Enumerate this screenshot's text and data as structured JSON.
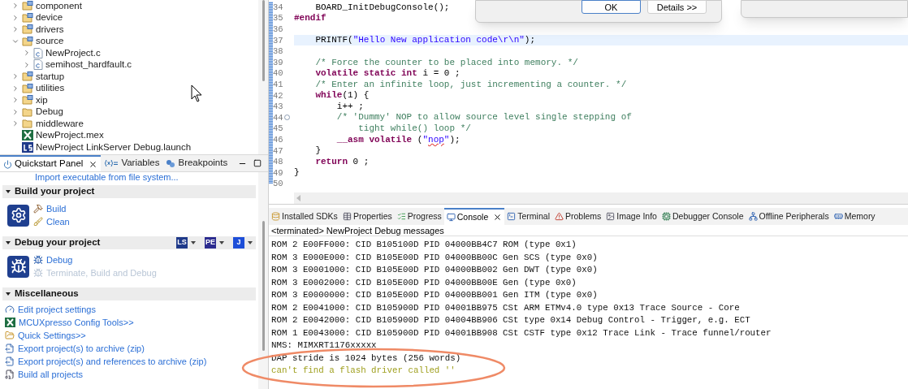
{
  "project_tree": [
    {
      "label": "component",
      "kind": "source_folder",
      "expanded": false
    },
    {
      "label": "device",
      "kind": "source_folder",
      "expanded": false
    },
    {
      "label": "drivers",
      "kind": "source_folder",
      "expanded": false
    },
    {
      "label": "source",
      "kind": "source_folder",
      "expanded": true,
      "children": [
        {
          "label": "NewProject.c",
          "kind": "c_file",
          "expanded": false
        },
        {
          "label": "semihost_hardfault.c",
          "kind": "c_file",
          "expanded": false
        }
      ]
    },
    {
      "label": "startup",
      "kind": "source_folder",
      "expanded": false
    },
    {
      "label": "utilities",
      "kind": "source_folder",
      "expanded": false
    },
    {
      "label": "xip",
      "kind": "source_folder",
      "expanded": false
    },
    {
      "label": "Debug",
      "kind": "folder",
      "expanded": false
    },
    {
      "label": "middleware",
      "kind": "folder",
      "expanded": false
    },
    {
      "label": "NewProject.mex",
      "kind": "mex_file"
    },
    {
      "label": "NewProject LinkServer Debug.launch",
      "kind": "launch_file"
    }
  ],
  "left_tabs": [
    {
      "label": "Quickstart Panel",
      "kind": "power",
      "selected": true
    },
    {
      "label": "Variables",
      "kind": "variables",
      "selected": false
    },
    {
      "label": "Breakpoints",
      "kind": "breakpoints",
      "selected": false
    }
  ],
  "quickstart": {
    "top_link": "Import executable from file system...",
    "sections": [
      {
        "title": "Build your project",
        "kind": "build",
        "items": [
          {
            "label": "Build",
            "kind": "hammer",
            "disabled": false
          },
          {
            "label": "Clean",
            "kind": "broom",
            "disabled": false
          }
        ]
      },
      {
        "title": "Debug your project",
        "kind": "debug",
        "probes": [
          {
            "label": "LS",
            "color": "#1f3a8a"
          },
          {
            "label": "PE",
            "color": "#2b2b8f"
          },
          {
            "label": "J",
            "color": "#1d4ed8"
          }
        ],
        "items": [
          {
            "label": "Debug",
            "kind": "bug",
            "disabled": false
          },
          {
            "label": "Terminate, Build and Debug",
            "kind": "bug",
            "disabled": true
          }
        ]
      },
      {
        "title": "Miscellaneous",
        "kind": "misc",
        "items": [
          {
            "label": "Edit project settings",
            "kind": "gauge",
            "disabled": false
          },
          {
            "label": "MCUXpresso Config Tools>>",
            "kind": "config",
            "disabled": false
          },
          {
            "label": "Quick Settings>>",
            "kind": "folder",
            "disabled": false
          },
          {
            "label": "Export project(s) to archive (zip)",
            "kind": "export",
            "disabled": false
          },
          {
            "label": "Export project(s) and references to archive (zip)",
            "kind": "export",
            "disabled": false
          },
          {
            "label": "Build all projects",
            "kind": "binary",
            "disabled": false
          }
        ]
      }
    ]
  },
  "editor": {
    "lines": [
      {
        "number": "34",
        "current": false,
        "segments": [
          {
            "kind": "plain",
            "text": "    BOARD_InitDebugConsole();"
          }
        ]
      },
      {
        "number": "35",
        "current": false,
        "segments": [
          {
            "kind": "directive",
            "text": "#endif"
          }
        ]
      },
      {
        "number": "36",
        "current": false
      },
      {
        "number": "37",
        "current": true,
        "segments": [
          {
            "kind": "plain",
            "text": "    PRINTF("
          },
          {
            "kind": "string",
            "text": "\"Hello New application code\\r\\n\""
          },
          {
            "kind": "plain",
            "text": ");"
          }
        ]
      },
      {
        "number": "38",
        "current": false
      },
      {
        "number": "39",
        "current": false,
        "segments": [
          {
            "kind": "comment",
            "text": "    /* Force the counter to be placed into memory. */"
          }
        ]
      },
      {
        "number": "40",
        "current": false,
        "segments": [
          {
            "kind": "keyword",
            "text": "    volatile static int"
          },
          {
            "kind": "plain",
            "text": " i = 0 ;"
          }
        ]
      },
      {
        "number": "41",
        "current": false,
        "segments": [
          {
            "kind": "comment",
            "text": "    /* Enter an infinite loop, just incrementing a counter. */"
          }
        ]
      },
      {
        "number": "42",
        "current": false,
        "segments": [
          {
            "kind": "keyword",
            "text": "    while"
          },
          {
            "kind": "plain",
            "text": "(1) {"
          }
        ]
      },
      {
        "number": "43",
        "current": false,
        "segments": [
          {
            "kind": "plain",
            "text": "        i++ ;"
          }
        ]
      },
      {
        "number": "44",
        "current": false,
        "fold": true,
        "segments": [
          {
            "kind": "comment",
            "text": "        /* 'Dummy' NOP to allow source level single stepping of"
          }
        ]
      },
      {
        "number": "45",
        "current": false,
        "segments": [
          {
            "kind": "comment",
            "text": "            tight while() loop */"
          }
        ]
      },
      {
        "number": "46",
        "current": false,
        "segments": [
          {
            "kind": "keyword",
            "text": "        __asm volatile"
          },
          {
            "kind": "plain",
            "text": " ("
          },
          {
            "kind": "string",
            "text": "\""
          },
          {
            "kind": "misspelled",
            "text": "nop"
          },
          {
            "kind": "string",
            "text": "\""
          },
          {
            "kind": "plain",
            "text": ");"
          }
        ]
      },
      {
        "number": "47",
        "current": false,
        "segments": [
          {
            "kind": "plain",
            "text": "    }"
          }
        ]
      },
      {
        "number": "48",
        "current": false,
        "segments": [
          {
            "kind": "keyword",
            "text": "    return"
          },
          {
            "kind": "plain",
            "text": " 0 ;"
          }
        ]
      },
      {
        "number": "49",
        "current": false,
        "segments": [
          {
            "kind": "plain",
            "text": "}"
          }
        ]
      },
      {
        "number": "50",
        "current": false
      }
    ]
  },
  "dialog": {
    "buttons": [
      {
        "label": "OK",
        "default": true
      },
      {
        "label": "Details >>",
        "default": false
      }
    ]
  },
  "bottom_tabs": [
    {
      "label": "Installed SDKs",
      "kind": "sdk",
      "selected": false
    },
    {
      "label": "Properties",
      "kind": "table",
      "selected": false
    },
    {
      "label": "Progress",
      "kind": "progress",
      "selected": false
    },
    {
      "label": "Console",
      "kind": "console",
      "selected": true
    },
    {
      "label": "Terminal",
      "kind": "terminal",
      "selected": false
    },
    {
      "label": "Problems",
      "kind": "problems",
      "selected": false
    },
    {
      "label": "Image Info",
      "kind": "image",
      "selected": false
    },
    {
      "label": "Debugger Console",
      "kind": "debugger",
      "selected": false
    },
    {
      "label": "Offline Peripherals",
      "kind": "peripherals",
      "selected": false
    },
    {
      "label": "Memory",
      "kind": "memory",
      "selected": false
    }
  ],
  "console": {
    "title": "<terminated> NewProject Debug messages",
    "lines": [
      {
        "kind": "info",
        "text": "ROM 2 E00FF000: CID B105100D PID 04000BB4C7 ROM (type 0x1)"
      },
      {
        "kind": "info",
        "text": "ROM 3 E000E000: CID B105E00D PID 04000BB00C Gen SCS (type 0x0)"
      },
      {
        "kind": "info",
        "text": "ROM 3 E0001000: CID B105E00D PID 04000BB002 Gen DWT (type 0x0)"
      },
      {
        "kind": "info",
        "text": "ROM 3 E0002000: CID B105E00D PID 04000BB00E Gen (type 0x0)"
      },
      {
        "kind": "info",
        "text": "ROM 3 E0000000: CID B105E00D PID 04000BB001 Gen ITM (type 0x0)"
      },
      {
        "kind": "info",
        "text": "ROM 2 E0041000: CID B105900D PID 04001BB975 CSt ARM ETMv4.0 type 0x13 Trace Source - Core"
      },
      {
        "kind": "info",
        "text": "ROM 2 E0042000: CID B105900D PID 04004BB906 CSt type 0x14 Debug Control - Trigger, e.g. ECT"
      },
      {
        "kind": "info",
        "text": "ROM 1 E0043000: CID B105900D PID 04001BB908 CSt CSTF type 0x12 Trace Link - Trace funnel/router"
      },
      {
        "kind": "info",
        "text": "NMS: MIMXRT1176xxxxx"
      },
      {
        "kind": "info",
        "text": "DAP stride is 1024 bytes (256 words)"
      },
      {
        "kind": "warning",
        "text": "can't find a flash driver called ''"
      }
    ]
  }
}
